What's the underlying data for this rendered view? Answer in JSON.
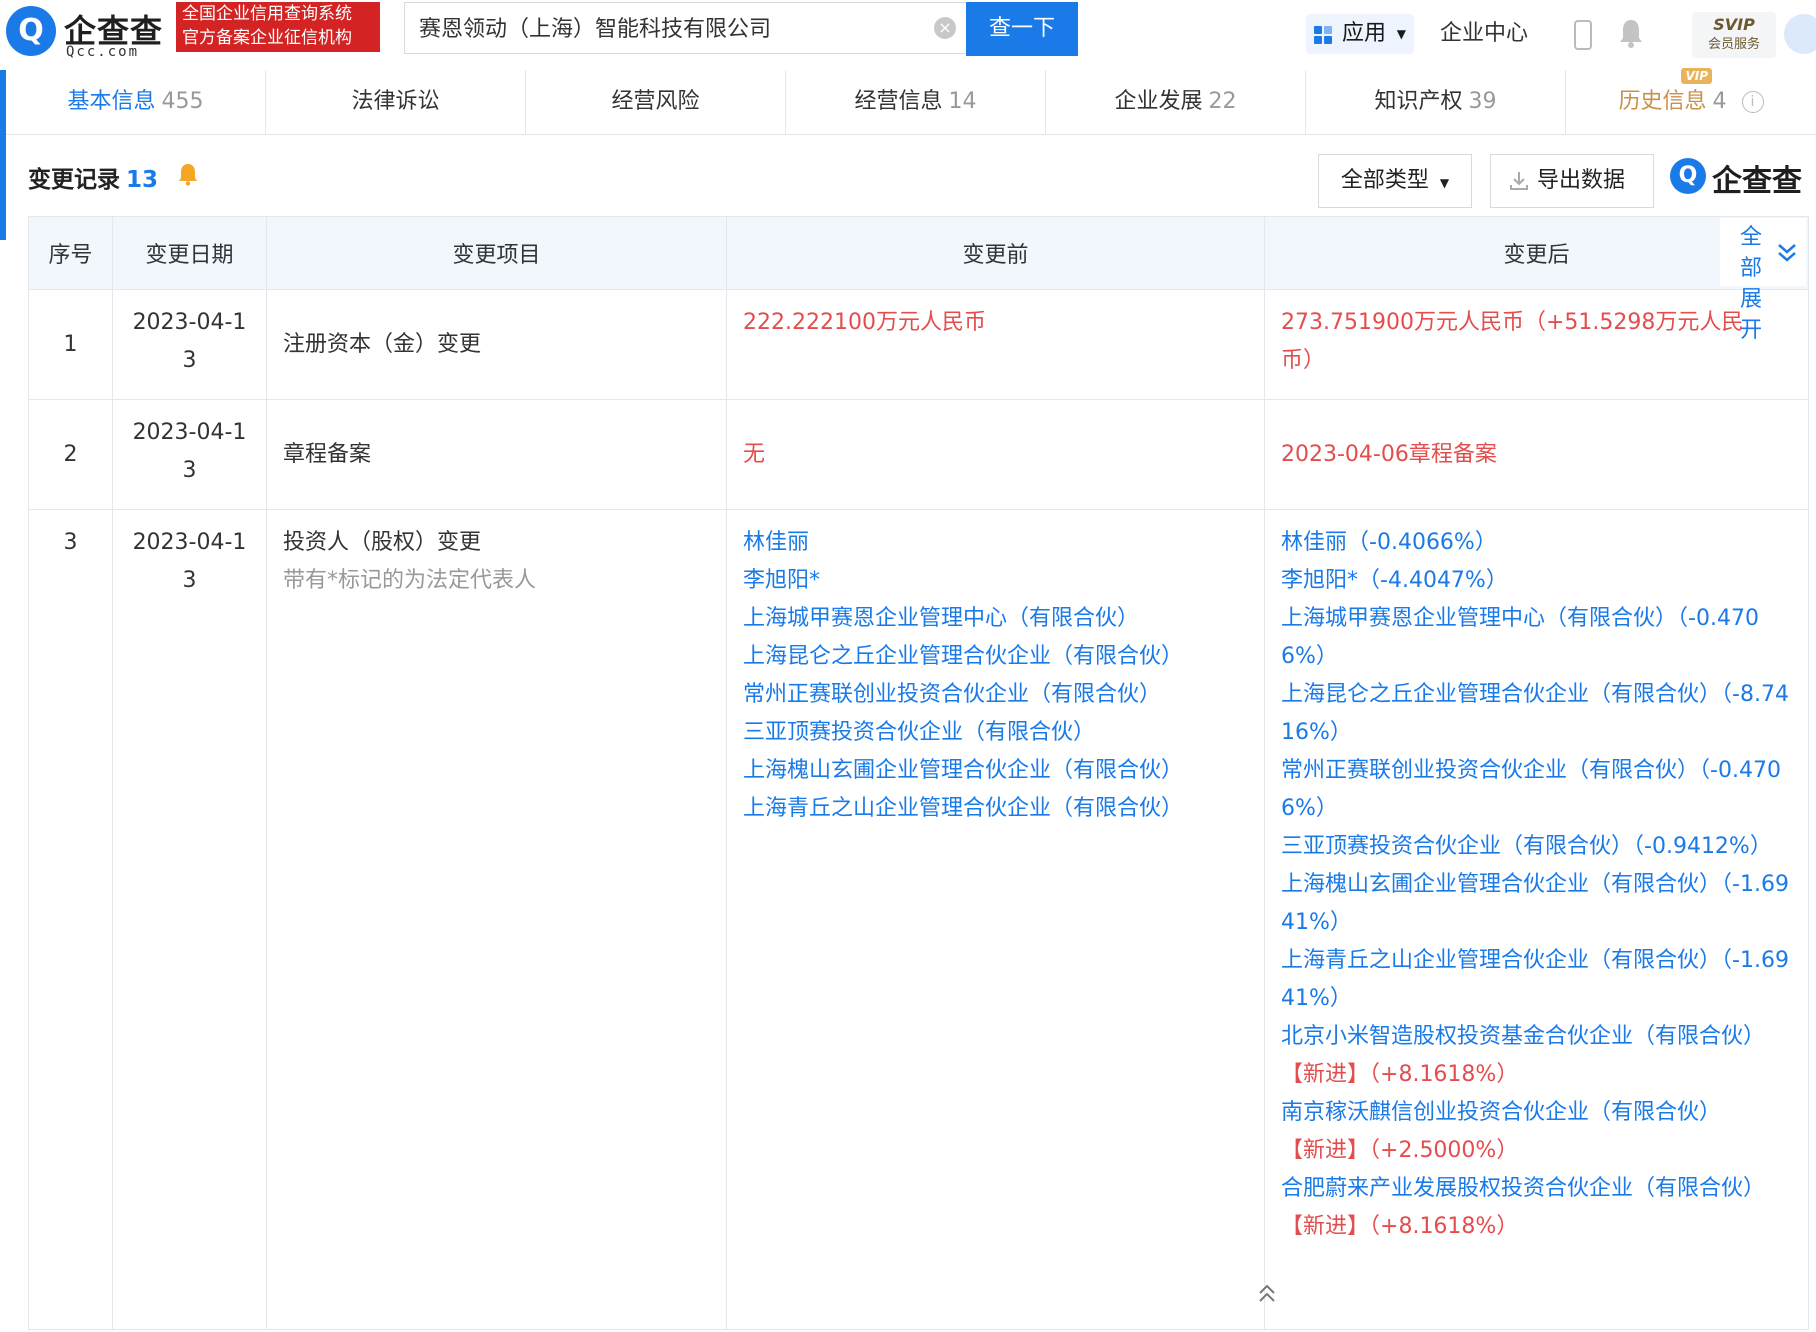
{
  "header": {
    "logo": {
      "glyph": "Q",
      "name": "企查查",
      "domain": "Qcc.com"
    },
    "official_badge": {
      "line1": "全国企业信用查询系统",
      "line2": "官方备案企业征信机构"
    },
    "search": {
      "value": "赛恩领动（上海）智能科技有限公司",
      "clear_icon": "×",
      "button": "查一下"
    },
    "nav": {
      "apps": "应用",
      "enterprise_center": "企业中心"
    },
    "svip": {
      "title": "SVIP",
      "subtitle": "会员服务"
    }
  },
  "tabs": [
    {
      "label": "基本信息",
      "count": "455",
      "active": true
    },
    {
      "label": "法律诉讼",
      "count": ""
    },
    {
      "label": "经营风险",
      "count": ""
    },
    {
      "label": "经营信息",
      "count": "14"
    },
    {
      "label": "企业发展",
      "count": "22"
    },
    {
      "label": "知识产权",
      "count": "39"
    },
    {
      "label": "历史信息",
      "count": "4",
      "vip": "VIP"
    }
  ],
  "section": {
    "title": "变更记录",
    "count": "13",
    "type_filter": "全部类型",
    "export": "导出数据",
    "brand": "企查查"
  },
  "table": {
    "headers": [
      "序号",
      "变更日期",
      "变更项目",
      "变更前",
      "变更后"
    ],
    "expand_all": "全部展开",
    "rows": [
      {
        "index": "1",
        "date": "2023-04-13",
        "item": "注册资本（金）变更",
        "before": [
          "222.222100万元人民币"
        ],
        "after": [
          "273.751900万元人民币（+51.5298万元人民币）"
        ]
      },
      {
        "index": "2",
        "date": "2023-04-13",
        "item": "章程备案",
        "before": [
          "无"
        ],
        "after": [
          "2023-04-06章程备案"
        ]
      },
      {
        "index": "3",
        "date": "2023-04-13",
        "item": "投资人（股权）变更",
        "note": "带有*标记的为法定代表人",
        "before": [
          "林佳丽",
          "李旭阳*",
          "上海城甲赛恩企业管理中心（有限合伙）",
          "上海昆仑之丘企业管理合伙企业（有限合伙）",
          "常州正赛联创业投资合伙企业（有限合伙）",
          "三亚顶赛投资合伙企业（有限合伙）",
          "上海槐山玄圃企业管理合伙企业（有限合伙）",
          "上海青丘之山企业管理合伙企业（有限合伙）"
        ],
        "after": [
          {
            "name": "林佳丽",
            "change": "（-0.4066%）"
          },
          {
            "name": "李旭阳*",
            "change": "（-4.4047%）"
          },
          {
            "name": "上海城甲赛恩企业管理中心（有限合伙）",
            "change": "（-0.4706%）"
          },
          {
            "name": "上海昆仑之丘企业管理合伙企业（有限合伙）",
            "change": "（-8.7416%）"
          },
          {
            "name": "常州正赛联创业投资合伙企业（有限合伙）",
            "change": "（-0.4706%）"
          },
          {
            "name": "三亚顶赛投资合伙企业（有限合伙）",
            "change": "（-0.9412%）"
          },
          {
            "name": "上海槐山玄圃企业管理合伙企业（有限合伙）",
            "change": "（-1.6941%）"
          },
          {
            "name": "上海青丘之山企业管理合伙企业（有限合伙）",
            "change": "（-1.6941%）"
          },
          {
            "name": "北京小米智造股权投资基金合伙企业（有限合伙）",
            "tag": "【新进】",
            "change": "（+8.1618%）"
          },
          {
            "name": "南京稼沃麒信创业投资合伙企业（有限合伙）",
            "tag": "【新进】",
            "change": "（+2.5000%）"
          },
          {
            "name": "合肥蔚来产业发展股权投资合伙企业（有限合伙）",
            "tag": "【新进】",
            "change": "（+8.1618%）"
          }
        ]
      }
    ]
  },
  "colors": {
    "brand_blue": "#1a7ae8",
    "red": "#e44d4d",
    "badge_red": "#d32323",
    "vip_gold": "#e9b35a"
  }
}
